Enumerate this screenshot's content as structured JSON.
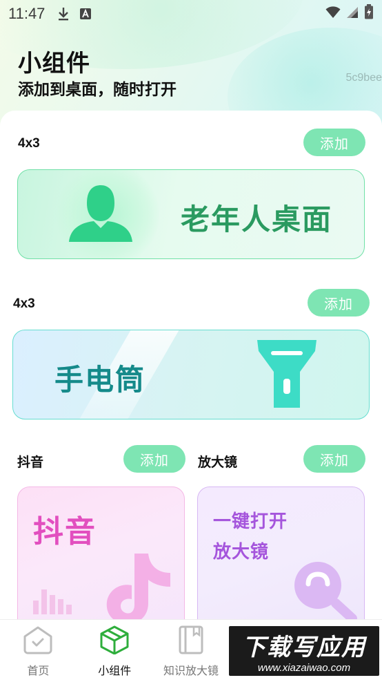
{
  "status_bar": {
    "time": "11:47",
    "icons": [
      "download-icon",
      "a-icon",
      "wifi-icon",
      "signal-icon",
      "battery-icon"
    ]
  },
  "header": {
    "title": "小组件",
    "subtitle": "添加到桌面，随时打开",
    "code": "5c9bee"
  },
  "widgets": [
    {
      "size_label": "4x3",
      "add_label": "添加",
      "card_title": "老年人桌面",
      "icon": "person-icon"
    },
    {
      "size_label": "4x3",
      "add_label": "添加",
      "card_title": "手电筒",
      "icon": "flashlight-icon"
    },
    {
      "size_label": "抖音",
      "add_label": "添加",
      "card_title": "抖音",
      "icon": "tiktok-icon"
    },
    {
      "size_label": "放大镜",
      "add_label": "添加",
      "card_title_line1": "一键打开",
      "card_title_line2": "放大镜",
      "icon": "magnifier-icon"
    }
  ],
  "colors": {
    "accent_green": "#7ee5b3",
    "elder_text": "#2a9a60",
    "flash_text": "#158a8a",
    "douyin_text": "#e24fbf",
    "magnifier_text": "#a555dc",
    "tab_active": "#2fae3c"
  },
  "tabbar": {
    "tabs": [
      {
        "label": "首页",
        "icon": "home-icon",
        "active": false
      },
      {
        "label": "小组件",
        "icon": "cube-icon",
        "active": true
      },
      {
        "label": "知识放大镜",
        "icon": "book-icon",
        "active": false
      }
    ]
  },
  "watermark": {
    "main": "下载写应用",
    "url": "www.xiazaiwao.com"
  }
}
